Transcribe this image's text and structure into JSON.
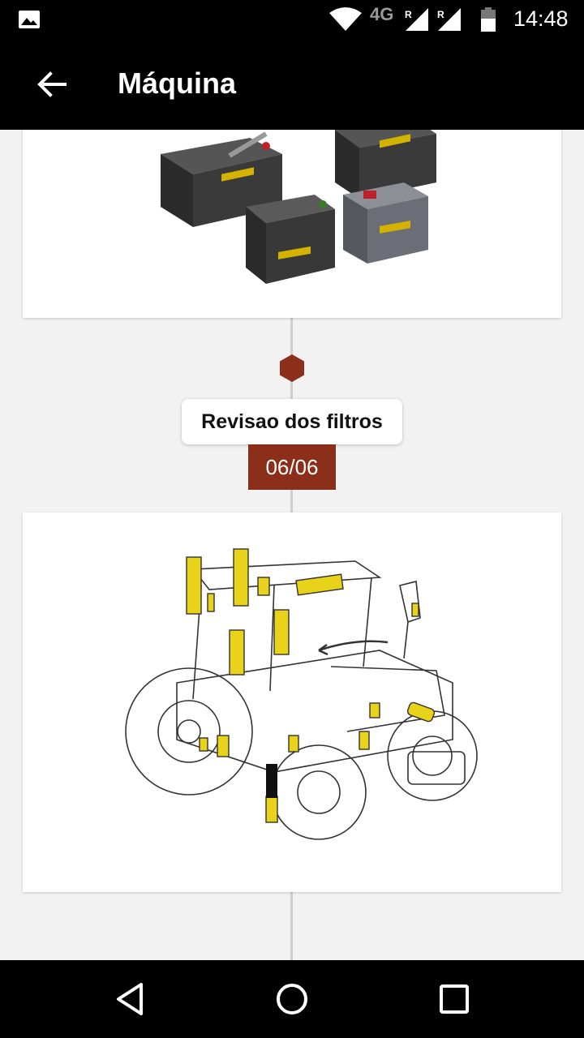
{
  "status_bar": {
    "network_type": "4G",
    "time": "14:48",
    "icons": [
      "image-icon",
      "wifi-icon",
      "signal-icon",
      "signal-icon",
      "battery-icon"
    ]
  },
  "app_bar": {
    "title": "Máquina",
    "back_icon": "arrow-back-icon"
  },
  "timeline": {
    "item": {
      "title": "Revisao dos filtros",
      "date": "06/06",
      "marker_color": "#8b2e1a"
    },
    "images": [
      "batteries-image",
      "tractor-filters-image"
    ]
  },
  "nav_bar": {
    "icons": [
      "back-triangle-icon",
      "home-circle-icon",
      "recents-square-icon"
    ]
  },
  "colors": {
    "accent": "#8b2e1a",
    "bars": "#000000",
    "background": "#f2f2f2"
  }
}
